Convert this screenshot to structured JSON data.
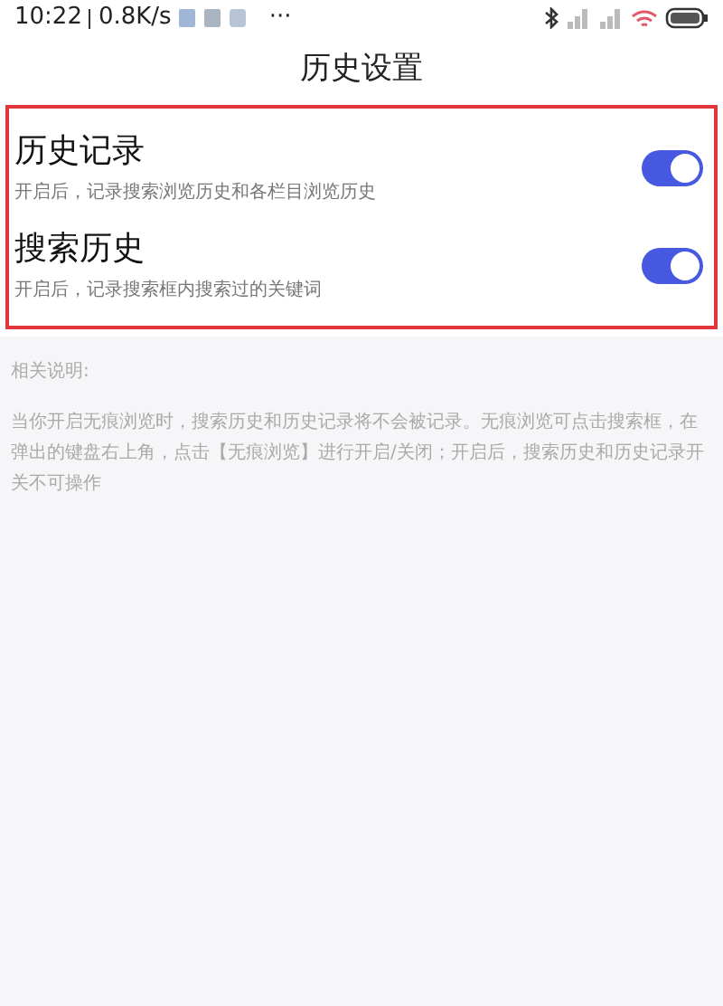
{
  "status_bar": {
    "time": "10:22",
    "speed": "0.8K/s",
    "more": "···"
  },
  "title": "历史设置",
  "settings": [
    {
      "title": "历史记录",
      "description": "开启后，记录搜索浏览历史和各栏目浏览历史",
      "on": true
    },
    {
      "title": "搜索历史",
      "description": "开启后，记录搜索框内搜索过的关键词",
      "on": true
    }
  ],
  "notes": {
    "heading": "相关说明:",
    "body": "当你开启无痕浏览时，搜索历史和历史记录将不会被记录。无痕浏览可点击搜索框，在弹出的键盘右上角，点击【无痕浏览】进行开启/关闭；开启后，搜索历史和历史记录开关不可操作"
  }
}
